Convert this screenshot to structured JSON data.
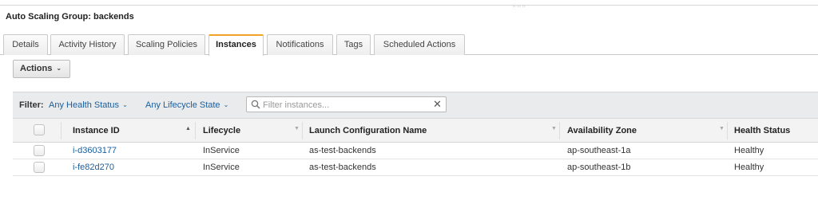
{
  "window": {
    "drag_handle": "⠒⠒⠒",
    "title": "Auto Scaling Group: backends"
  },
  "tabs": [
    {
      "label": "Details",
      "active": false
    },
    {
      "label": "Activity History",
      "active": false
    },
    {
      "label": "Scaling Policies",
      "active": false
    },
    {
      "label": "Instances",
      "active": true
    },
    {
      "label": "Notifications",
      "active": false
    },
    {
      "label": "Tags",
      "active": false
    },
    {
      "label": "Scheduled Actions",
      "active": false
    }
  ],
  "toolbar": {
    "actions_label": "Actions",
    "actions_chevron": "⌄"
  },
  "filter": {
    "label": "Filter:",
    "health_status": "Any Health Status",
    "lifecycle_state": "Any Lifecycle State",
    "chevron": "⌄",
    "search_placeholder": "Filter instances...",
    "search_value": "",
    "clear_symbol": "✕"
  },
  "table": {
    "columns": [
      {
        "label": "Instance ID",
        "sort": "▲"
      },
      {
        "label": "Lifecycle",
        "sort": "▼"
      },
      {
        "label": "Launch Configuration Name",
        "sort": "▼"
      },
      {
        "label": "Availability Zone",
        "sort": "▼"
      },
      {
        "label": "Health Status"
      }
    ],
    "rows": [
      {
        "instance_id": "i-d3603177",
        "lifecycle": "InService",
        "launch_config": "as-test-backends",
        "zone": "ap-southeast-1a",
        "health": "Healthy"
      },
      {
        "instance_id": "i-fe82d270",
        "lifecycle": "InService",
        "launch_config": "as-test-backends",
        "zone": "ap-southeast-1b",
        "health": "Healthy"
      }
    ]
  },
  "colors": {
    "link": "#1a5e9e",
    "active_tab_accent": "#f0a324",
    "filter_bar_bg": "#e9ebed"
  }
}
